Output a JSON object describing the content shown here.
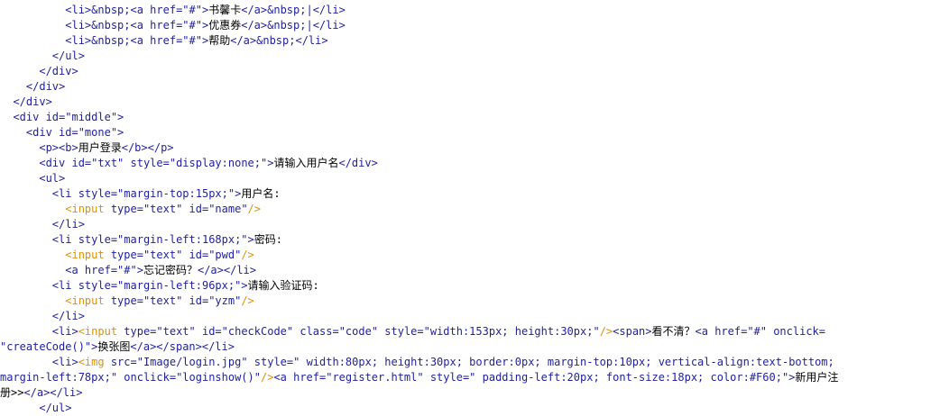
{
  "lines": [
    {
      "indent": "          ",
      "tokens": [
        {
          "t": "<li>&nbsp;<a href=\"#\">",
          "c": "tok-blue"
        },
        {
          "t": "书馨卡",
          "c": "tok-text"
        },
        {
          "t": "</a>&nbsp;|</li>",
          "c": "tok-blue"
        }
      ]
    },
    {
      "indent": "          ",
      "tokens": [
        {
          "t": "<li>&nbsp;<a href=\"#\">",
          "c": "tok-blue"
        },
        {
          "t": "优惠券",
          "c": "tok-text"
        },
        {
          "t": "</a>&nbsp;|</li>",
          "c": "tok-blue"
        }
      ]
    },
    {
      "indent": "          ",
      "tokens": [
        {
          "t": "<li>&nbsp;<a href=\"#\">",
          "c": "tok-blue"
        },
        {
          "t": "帮助",
          "c": "tok-text"
        },
        {
          "t": "</a>&nbsp;</li>",
          "c": "tok-blue"
        }
      ]
    },
    {
      "indent": "        ",
      "tokens": [
        {
          "t": "</ul>",
          "c": "tok-blue"
        }
      ]
    },
    {
      "indent": "      ",
      "tokens": [
        {
          "t": "</div>",
          "c": "tok-blue"
        }
      ]
    },
    {
      "indent": "    ",
      "tokens": [
        {
          "t": "</div>",
          "c": "tok-blue"
        }
      ]
    },
    {
      "indent": "  ",
      "tokens": [
        {
          "t": "</div>",
          "c": "tok-blue"
        }
      ]
    },
    {
      "indent": "  ",
      "tokens": [
        {
          "t": "<div id=\"middle\">",
          "c": "tok-blue"
        }
      ]
    },
    {
      "indent": "    ",
      "tokens": [
        {
          "t": "<div id=\"mone\">",
          "c": "tok-blue"
        }
      ]
    },
    {
      "indent": "      ",
      "tokens": [
        {
          "t": "<p><b>",
          "c": "tok-blue"
        },
        {
          "t": "用户登录",
          "c": "tok-text"
        },
        {
          "t": "</b></p>",
          "c": "tok-blue"
        }
      ]
    },
    {
      "indent": "      ",
      "tokens": [
        {
          "t": "<div id=\"txt\" style=\"display:none;\">",
          "c": "tok-blue"
        },
        {
          "t": "请输入用户名",
          "c": "tok-text"
        },
        {
          "t": "</div>",
          "c": "tok-blue"
        }
      ]
    },
    {
      "indent": "      ",
      "tokens": [
        {
          "t": "<ul>",
          "c": "tok-blue"
        }
      ]
    },
    {
      "indent": "        ",
      "tokens": [
        {
          "t": "<li style=\"margin-top:15px;\">",
          "c": "tok-blue"
        },
        {
          "t": "用户名:",
          "c": "tok-text"
        }
      ]
    },
    {
      "indent": "          ",
      "tokens": [
        {
          "t": "<input ",
          "c": "tok-orange"
        },
        {
          "t": "type=\"text\" id=\"name\"",
          "c": "tok-blue"
        },
        {
          "t": "/>",
          "c": "tok-orange"
        }
      ]
    },
    {
      "indent": "        ",
      "tokens": [
        {
          "t": "</li>",
          "c": "tok-blue"
        }
      ]
    },
    {
      "indent": "        ",
      "tokens": [
        {
          "t": "<li style=\"margin-left:168px;\">",
          "c": "tok-blue"
        },
        {
          "t": "密码:",
          "c": "tok-text"
        }
      ]
    },
    {
      "indent": "          ",
      "tokens": [
        {
          "t": "<input ",
          "c": "tok-orange"
        },
        {
          "t": "type=\"text\" id=\"pwd\"",
          "c": "tok-blue"
        },
        {
          "t": "/>",
          "c": "tok-orange"
        }
      ]
    },
    {
      "indent": "          ",
      "tokens": [
        {
          "t": "<a href=\"#\">",
          "c": "tok-blue"
        },
        {
          "t": "忘记密码？",
          "c": "tok-text"
        },
        {
          "t": "</a></li>",
          "c": "tok-blue"
        }
      ]
    },
    {
      "indent": "        ",
      "tokens": [
        {
          "t": "<li style=\"margin-left:96px;\">",
          "c": "tok-blue"
        },
        {
          "t": "请输入验证码:",
          "c": "tok-text"
        }
      ]
    },
    {
      "indent": "          ",
      "tokens": [
        {
          "t": "<input ",
          "c": "tok-orange"
        },
        {
          "t": "type=\"text\" id=\"yzm\"",
          "c": "tok-blue"
        },
        {
          "t": "/>",
          "c": "tok-orange"
        }
      ]
    },
    {
      "indent": "        ",
      "tokens": [
        {
          "t": "</li>",
          "c": "tok-blue"
        }
      ]
    },
    {
      "indent": "        ",
      "tokens": [
        {
          "t": "<li>",
          "c": "tok-blue"
        },
        {
          "t": "<input ",
          "c": "tok-orange"
        },
        {
          "t": "type=\"text\" id=\"checkCode\" class=\"code\" style=\"width:153px; height:30px;\"",
          "c": "tok-blue"
        },
        {
          "t": "/>",
          "c": "tok-orange"
        },
        {
          "t": "<span>",
          "c": "tok-blue"
        },
        {
          "t": "看不清？",
          "c": "tok-text"
        },
        {
          "t": "<a href=\"#\" onclick=",
          "c": "tok-blue"
        }
      ]
    },
    {
      "indent": "",
      "tokens": [
        {
          "t": "\"createCode()\">",
          "c": "tok-blue"
        },
        {
          "t": "换张图",
          "c": "tok-text"
        },
        {
          "t": "</a></span></li>",
          "c": "tok-blue"
        }
      ]
    },
    {
      "indent": "        ",
      "tokens": [
        {
          "t": "<li>",
          "c": "tok-blue"
        },
        {
          "t": "<img ",
          "c": "tok-orange"
        },
        {
          "t": "src=\"Image/login.jpg\" style=\" width:80px; height:30px; border:0px; margin-top:10px; vertical-align:text-bottom;",
          "c": "tok-blue"
        }
      ]
    },
    {
      "indent": "",
      "tokens": [
        {
          "t": "margin-left:78px;\" onclick=\"loginshow()\"",
          "c": "tok-blue"
        },
        {
          "t": "/>",
          "c": "tok-orange"
        },
        {
          "t": "<a href=\"register.html\" style=\" padding-left:20px; font-size:18px; color:#F60;\">",
          "c": "tok-blue"
        },
        {
          "t": "新用户注",
          "c": "tok-text"
        }
      ]
    },
    {
      "indent": "",
      "tokens": [
        {
          "t": "册>>",
          "c": "tok-text"
        },
        {
          "t": "</a></li>",
          "c": "tok-blue"
        }
      ]
    },
    {
      "indent": "      ",
      "tokens": [
        {
          "t": "</ul>",
          "c": "tok-blue"
        }
      ]
    }
  ]
}
